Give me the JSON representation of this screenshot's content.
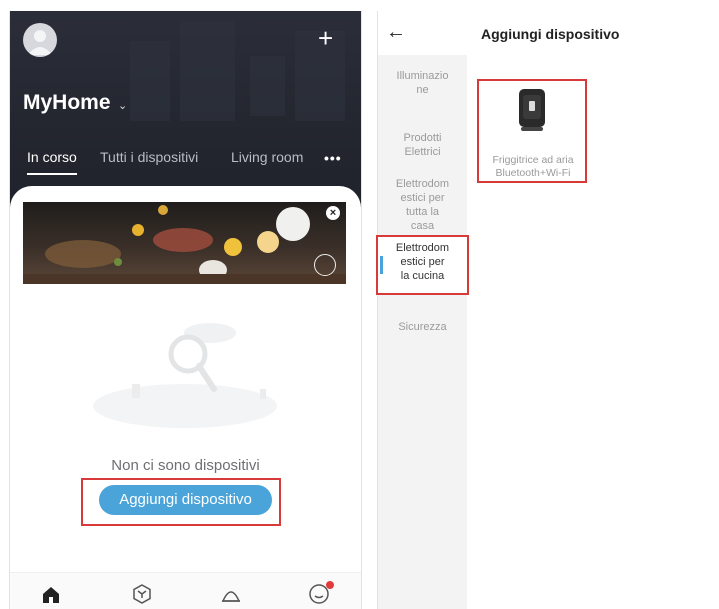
{
  "left": {
    "home_title": "MyHome",
    "tabs": [
      "In corso",
      "Tutti i dispositivi",
      "Living room"
    ],
    "empty_text": "Non ci sono dispositivi",
    "add_button_label": "Aggiungi dispositivo",
    "icons": [
      "avatar-icon",
      "plus-icon",
      "close-icon",
      "tap-hand-icon",
      "home-icon",
      "cube-icon",
      "scene-bell-icon",
      "profile-icon"
    ]
  },
  "right": {
    "title": "Aggiungi dispositivo",
    "categories": [
      "Illuminazione",
      "Prodotti Elettrici",
      "Elettrodomestici per tutta la casa",
      "Elettrodomestici per la cucina",
      "Sicurezza"
    ],
    "category_lines": [
      [
        "Illuminazio",
        "ne"
      ],
      [
        "Prodotti",
        "Elettrici"
      ],
      [
        "Elettrodom",
        "estici per",
        "tutta la",
        "casa"
      ],
      [
        "Elettrodom",
        "estici per",
        "la cucina"
      ],
      [
        "Sicurezza"
      ]
    ],
    "selected_category": "Elettrodomestici per la cucina",
    "device_lines": [
      "Friggitrice ad aria",
      "Bluetooth+Wi-Fi"
    ]
  },
  "colors": {
    "header_dark": "#23262f",
    "accent_blue": "#4aa4d9",
    "highlight_red": "#d83a3a"
  }
}
